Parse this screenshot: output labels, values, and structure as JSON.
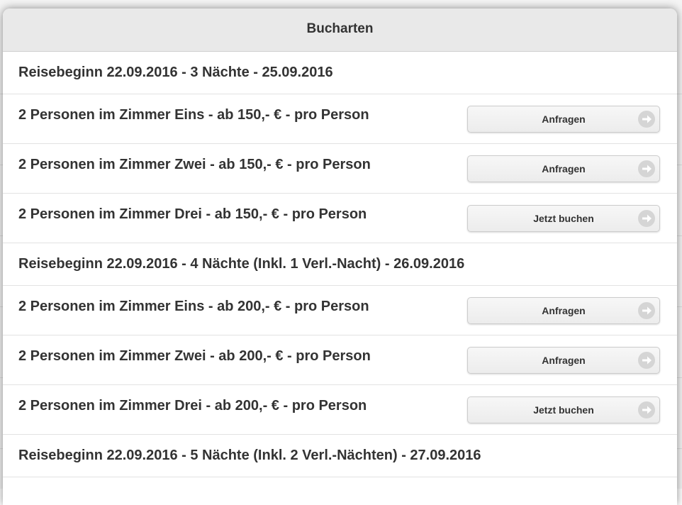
{
  "dialog": {
    "title": "Bucharten"
  },
  "rows": [
    {
      "type": "divider",
      "text": "Reisebeginn 22.09.2016 - 3 Nächte - 25.09.2016"
    },
    {
      "type": "offer",
      "text": "2 Personen im Zimmer Eins - ab 150,- € - pro Person",
      "button": "Anfragen"
    },
    {
      "type": "offer",
      "text": "2 Personen im Zimmer Zwei - ab 150,- € - pro Person",
      "button": "Anfragen"
    },
    {
      "type": "offer",
      "text": "2 Personen im Zimmer Drei - ab 150,- € - pro Person",
      "button": "Jetzt buchen"
    },
    {
      "type": "divider",
      "text": "Reisebeginn 22.09.2016 - 4 Nächte (Inkl. 1 Verl.-Nacht) - 26.09.2016"
    },
    {
      "type": "offer",
      "text": "2 Personen im Zimmer Eins - ab 200,- € - pro Person",
      "button": "Anfragen"
    },
    {
      "type": "offer",
      "text": "2 Personen im Zimmer Zwei - ab 200,- € - pro Person",
      "button": "Anfragen"
    },
    {
      "type": "offer",
      "text": "2 Personen im Zimmer Drei - ab 200,- € - pro Person",
      "button": "Jetzt buchen"
    },
    {
      "type": "divider",
      "text": "Reisebeginn 22.09.2016 - 5 Nächte (Inkl. 2 Verl.-Nächten) - 27.09.2016"
    }
  ],
  "icons": {
    "button_arrow": "arrow-right-circle-icon"
  }
}
